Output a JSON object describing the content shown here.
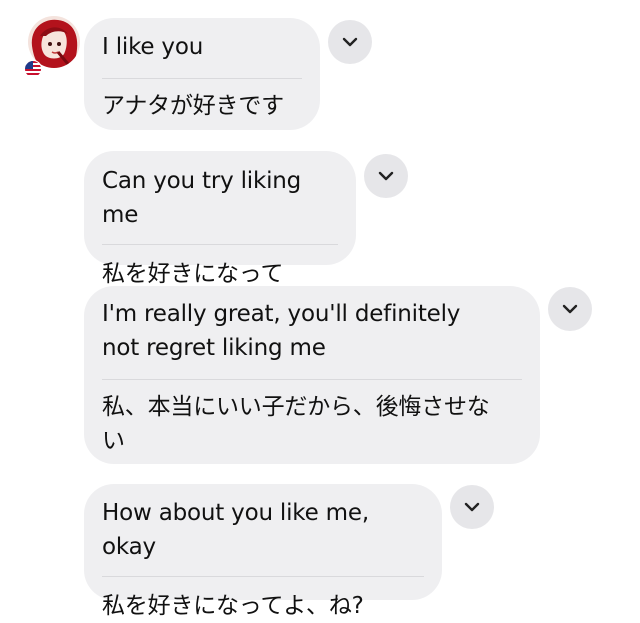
{
  "messages": [
    {
      "original": "I like you",
      "translation": "アナタが好きです"
    },
    {
      "original": "Can you try liking me",
      "translation": "私を好きになって"
    },
    {
      "original": "I'm really great, you'll definitely not regret liking me",
      "translation": "私、本当にいい子だから、後悔させない"
    },
    {
      "original": "How about you like me, okay",
      "translation": "私を好きになってよ、ね?"
    }
  ],
  "colors": {
    "bubble_bg": "#efeff1",
    "chevron_bg": "#e6e6e9",
    "divider": "#d9d9dc"
  },
  "icons": {
    "avatar": "avatar-icon",
    "flag": "us-flag-icon",
    "chevron": "chevron-down-icon"
  }
}
